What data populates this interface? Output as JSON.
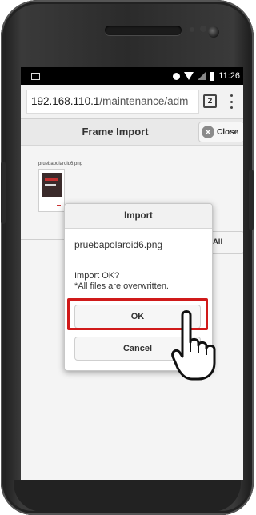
{
  "status_bar": {
    "time": "11:26"
  },
  "browser": {
    "url_host": "192.168.110.1",
    "url_path": "/maintenance/adm",
    "tab_count": "2"
  },
  "page": {
    "title": "Frame Import",
    "close_label": "Close",
    "import_all_label": "ort All",
    "file": {
      "name": "pruebapolaroid6.png"
    }
  },
  "dialog": {
    "title": "Import",
    "filename": "pruebapolaroid6.png",
    "message_line1": "Import OK?",
    "message_line2": "*All files are overwritten.",
    "ok_label": "OK",
    "cancel_label": "Cancel"
  },
  "colors": {
    "highlight": "#d01a1a",
    "status_bar": "#000000",
    "page_header": "#e9e9e9"
  }
}
